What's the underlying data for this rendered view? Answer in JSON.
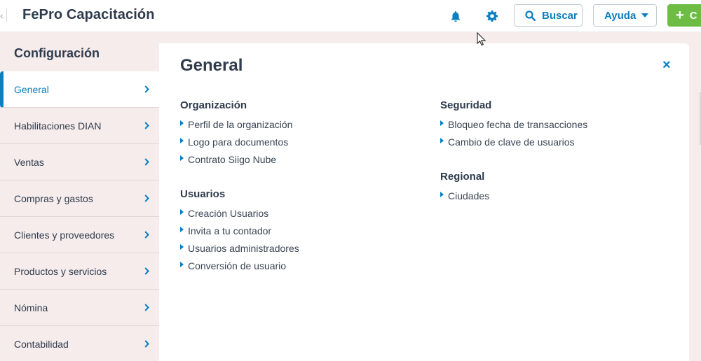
{
  "header": {
    "title": "FePro Capacitación",
    "search_label": "Buscar",
    "help_label": "Ayuda",
    "create_label": "C",
    "icons": {
      "notifications": "bell-icon",
      "settings": "gear-icon",
      "search": "search-icon"
    }
  },
  "colors": {
    "accent": "#0a7fc2",
    "create": "#6dbd45",
    "sidebar_bg": "#f6ecec",
    "text": "#2f3b4c"
  },
  "sidebar": {
    "title": "Configuración",
    "items": [
      {
        "label": "General",
        "active": true
      },
      {
        "label": "Habilitaciones DIAN"
      },
      {
        "label": "Ventas"
      },
      {
        "label": "Compras y gastos"
      },
      {
        "label": "Clientes y proveedores"
      },
      {
        "label": "Productos y servicios"
      },
      {
        "label": "Nómina"
      },
      {
        "label": "Contabilidad"
      }
    ]
  },
  "main": {
    "title": "General",
    "close_label": "×",
    "sections": {
      "organizacion": {
        "title": "Organización",
        "links": [
          "Perfil de la organización",
          "Logo para documentos",
          "Contrato Siigo Nube"
        ]
      },
      "usuarios": {
        "title": "Usuarios",
        "links": [
          "Creación Usuarios",
          "Invita a tu contador",
          "Usuarios administradores",
          "Conversión de usuario"
        ]
      },
      "seguridad": {
        "title": "Seguridad",
        "links": [
          "Bloqueo fecha de transacciones",
          "Cambio de clave de usuarios"
        ]
      },
      "regional": {
        "title": "Regional",
        "links": [
          "Ciudades"
        ]
      }
    }
  }
}
